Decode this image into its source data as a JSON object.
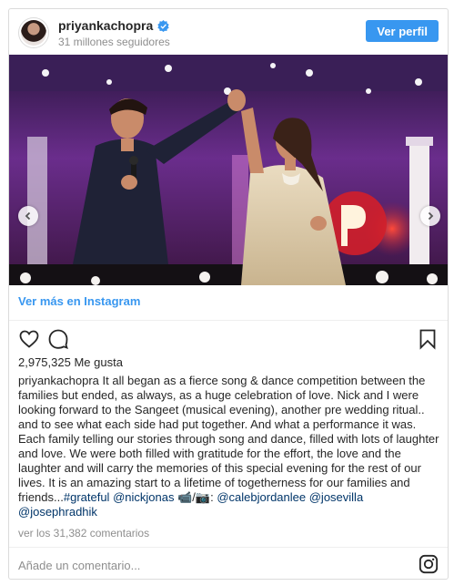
{
  "header": {
    "username": "priyankachopra",
    "followers": "31 millones seguidores",
    "view_profile": "Ver perfil"
  },
  "post": {
    "view_more": "Ver más en Instagram",
    "likes": "2,975,325 Me gusta",
    "caption_author": "priyankachopra",
    "caption_text": "It all began as a fierce song & dance competition between the families but ended, as always, as a huge celebration of love.  Nick and I were looking forward to the Sangeet (musical evening), another pre wedding ritual.. and to see what each side had put together. And what a performance it was. Each family telling our stories through song and dance, filled with lots of laughter and love. We were both filled with gratitude for the effort, the love and the laughter and will carry the memories of this special evening for the rest of our lives. It is an amazing start to a lifetime of togetherness for our families and friends...",
    "hashtag": "#grateful",
    "mention1": "@nickjonas",
    "emoji": "📹/📷:",
    "mention2": "@calebjordanlee",
    "mention3": "@josevilla",
    "mention4": "@josephradhik",
    "comments": "ver los 31,382 comentarios",
    "add_comment_placeholder": "Añade un comentario..."
  },
  "icons": {
    "verified": "verified-badge-icon",
    "like": "heart-icon",
    "comment": "comment-bubble-icon",
    "save": "bookmark-icon",
    "instagram": "instagram-logo-icon",
    "prev": "chevron-left-icon",
    "next": "chevron-right-icon"
  },
  "colors": {
    "accent": "#3897f0",
    "link_dark": "#003569",
    "muted": "#8e8e8e"
  }
}
